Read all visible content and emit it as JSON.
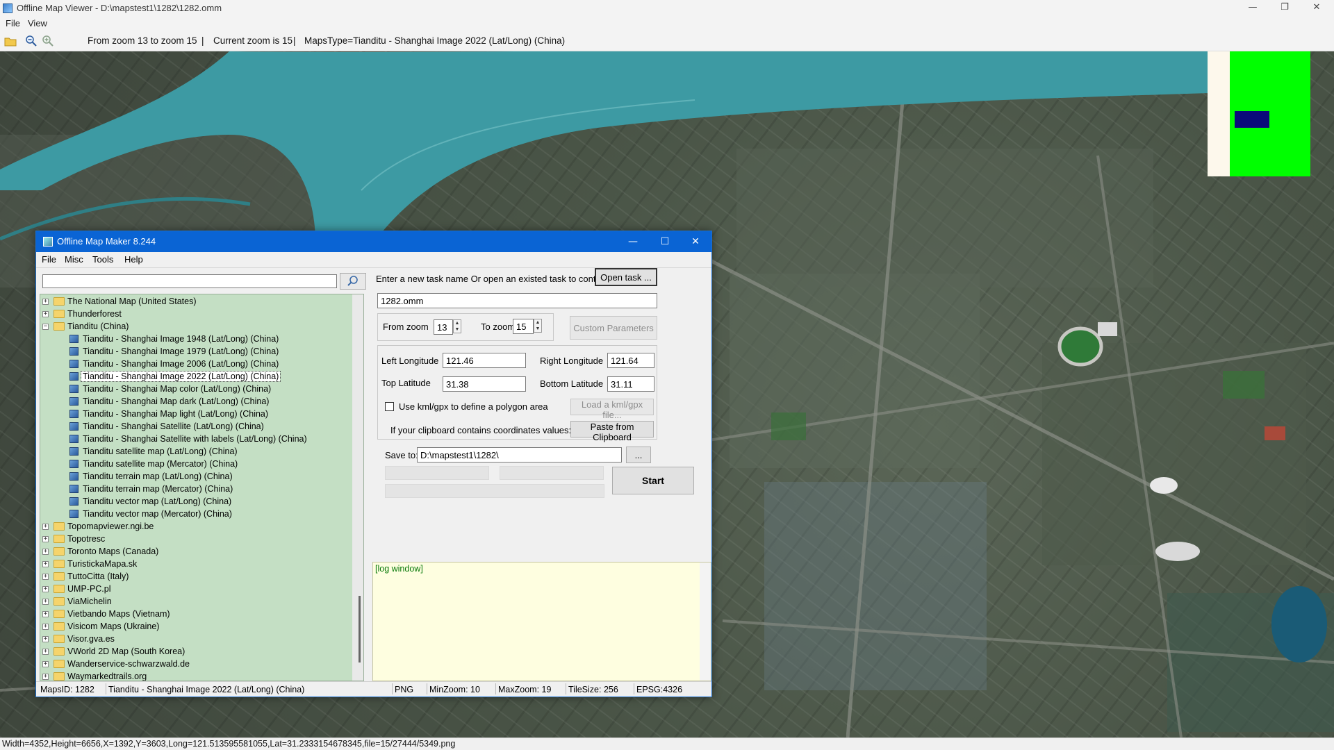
{
  "window": {
    "title": "Offline Map Viewer - D:\\mapstest1\\1282\\1282.omm",
    "controls": [
      "—",
      "❐",
      "✕"
    ]
  },
  "menubar": {
    "items": [
      "File",
      "View"
    ]
  },
  "toolbar": {
    "zoom_range": "From zoom 13 to zoom 15",
    "current_zoom": "Current zoom is 15",
    "maps_type": "MapsType=Tianditu - Shanghai Image 2022 (Lat/Long) (China)",
    "separator": "|"
  },
  "statusbar": {
    "text": "Width=4352,Height=6656,X=1392,Y=3603,Long=121.513595581055,Lat=31.2333154678345,file=15/27444/5349.png"
  },
  "dialog": {
    "title": "Offline Map Maker 8.244",
    "controls": [
      "—",
      "☐",
      "✕"
    ],
    "menu": [
      "File",
      "Misc",
      "Tools",
      "Help"
    ],
    "search": {
      "value": "",
      "icon": "magnifier-icon"
    },
    "tree": [
      {
        "label": "The National Map (United States)",
        "type": "folder",
        "expander": "+"
      },
      {
        "label": "Thunderforest",
        "type": "folder",
        "expander": "+"
      },
      {
        "label": "Tianditu (China)",
        "type": "folder",
        "expander": "−"
      },
      {
        "label": "Tianditu - Shanghai Image 1948 (Lat/Long) (China)",
        "type": "leaf"
      },
      {
        "label": "Tianditu - Shanghai Image 1979 (Lat/Long) (China)",
        "type": "leaf"
      },
      {
        "label": "Tianditu - Shanghai Image 2006 (Lat/Long) (China)",
        "type": "leaf"
      },
      {
        "label": "Tianditu - Shanghai Image 2022 (Lat/Long) (China)",
        "type": "leaf",
        "selected": true
      },
      {
        "label": "Tianditu - Shanghai Map color (Lat/Long) (China)",
        "type": "leaf"
      },
      {
        "label": "Tianditu - Shanghai Map dark (Lat/Long) (China)",
        "type": "leaf"
      },
      {
        "label": "Tianditu - Shanghai Map light (Lat/Long) (China)",
        "type": "leaf"
      },
      {
        "label": "Tianditu - Shanghai Satellite (Lat/Long) (China)",
        "type": "leaf"
      },
      {
        "label": "Tianditu - Shanghai Satellite with labels (Lat/Long) (China)",
        "type": "leaf"
      },
      {
        "label": "Tianditu satellite map (Lat/Long) (China)",
        "type": "leaf"
      },
      {
        "label": "Tianditu satellite map (Mercator) (China)",
        "type": "leaf"
      },
      {
        "label": "Tianditu terrain map (Lat/Long) (China)",
        "type": "leaf"
      },
      {
        "label": "Tianditu terrain map (Mercator) (China)",
        "type": "leaf"
      },
      {
        "label": "Tianditu vector map (Lat/Long) (China)",
        "type": "leaf"
      },
      {
        "label": "Tianditu vector map (Mercator) (China)",
        "type": "leaf"
      },
      {
        "label": "Topomapviewer.ngi.be",
        "type": "folder",
        "expander": "+"
      },
      {
        "label": "Topotresc",
        "type": "folder",
        "expander": "+"
      },
      {
        "label": "Toronto Maps (Canada)",
        "type": "folder",
        "expander": "+"
      },
      {
        "label": "TuristickaMapa.sk",
        "type": "folder",
        "expander": "+"
      },
      {
        "label": "TuttoCitta (Italy)",
        "type": "folder",
        "expander": "+"
      },
      {
        "label": "UMP-PC.pl",
        "type": "folder",
        "expander": "+"
      },
      {
        "label": "ViaMichelin",
        "type": "folder",
        "expander": "+"
      },
      {
        "label": "Vietbando Maps (Vietnam)",
        "type": "folder",
        "expander": "+"
      },
      {
        "label": "Visicom Maps (Ukraine)",
        "type": "folder",
        "expander": "+"
      },
      {
        "label": "Visor.gva.es",
        "type": "folder",
        "expander": "+"
      },
      {
        "label": "VWorld 2D Map (South Korea)",
        "type": "folder",
        "expander": "+"
      },
      {
        "label": "Wanderservice-schwarzwald.de",
        "type": "folder",
        "expander": "+"
      },
      {
        "label": "Waymarkedtrails.org",
        "type": "folder",
        "expander": "+"
      }
    ],
    "task": {
      "prompt": "Enter a new task name Or open an existed task to continue:",
      "open_button": "Open task ...",
      "name_value": "1282.omm"
    },
    "zoom": {
      "from_label": "From zoom",
      "from_value": "13",
      "to_label": "To zoom",
      "to_value": "15",
      "custom_button": "Custom Parameters"
    },
    "coords": {
      "left_lon_label": "Left Longitude",
      "left_lon_value": "121.46",
      "right_lon_label": "Right Longitude",
      "right_lon_value": "121.64",
      "top_lat_label": "Top Latitude",
      "top_lat_value": "31.38",
      "bottom_lat_label": "Bottom Latitude",
      "bottom_lat_value": "31.11",
      "kml_label": "Use kml/gpx to define a polygon area",
      "kml_checked": false,
      "load_kml_button": "Load a kml/gpx file...",
      "clipboard_label": "If your clipboard contains coordinates values:",
      "paste_button": "Paste from Clipboard"
    },
    "save": {
      "label": "Save to:",
      "value": "D:\\mapstest1\\1282\\",
      "browse_button": "...",
      "start_button": "Start"
    },
    "log": {
      "text": "[log window]"
    },
    "status": {
      "maps_id": "MapsID: 1282",
      "map_name": "Tianditu - Shanghai Image 2022 (Lat/Long) (China)",
      "format": "PNG",
      "min_zoom": "MinZoom: 10",
      "max_zoom": "MaxZoom: 19",
      "tile_size": "TileSize: 256",
      "epsg": "EPSG:4326"
    }
  },
  "colors": {
    "dialog_title": "#0a64d4",
    "tree_bg": "#c4dfc4",
    "log_bg": "#fefee0",
    "river": "#3d9aa3",
    "overview_green": "#00ff00",
    "overview_rect": "#0a0a7a"
  }
}
